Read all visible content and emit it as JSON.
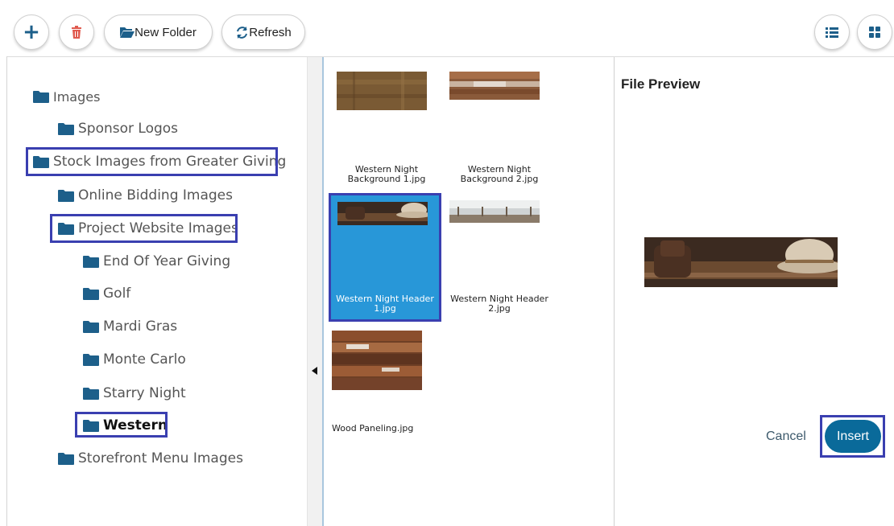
{
  "toolbar": {
    "add_icon_glyph": "+",
    "new_folder_label": "New Folder",
    "refresh_label": "Refresh"
  },
  "tree": {
    "items": [
      {
        "label": "Images",
        "level": 0
      },
      {
        "label": "Sponsor Logos",
        "level": 1
      },
      {
        "label": "Stock Images from Greater Giving",
        "level": 0
      },
      {
        "label": "Online Bidding Images",
        "level": 1
      },
      {
        "label": "Project Website Images",
        "level": 1
      },
      {
        "label": "End Of Year Giving",
        "level": 2
      },
      {
        "label": "Golf",
        "level": 2
      },
      {
        "label": "Mardi Gras",
        "level": 2
      },
      {
        "label": "Monte Carlo",
        "level": 2
      },
      {
        "label": "Starry Night",
        "level": 2
      },
      {
        "label": "Western",
        "level": 2,
        "selected": true
      },
      {
        "label": "Storefront Menu Images",
        "level": 1
      }
    ]
  },
  "files": [
    {
      "name": "Western Night Background 1.jpg",
      "selected": false
    },
    {
      "name": "Western Night Background 2.jpg",
      "selected": false
    },
    {
      "name": "Western Night Header 1.jpg",
      "selected": true
    },
    {
      "name": "Western Night Header 2.jpg",
      "selected": false
    },
    {
      "name": "Wood Paneling.jpg",
      "selected": false
    }
  ],
  "preview": {
    "title": "File Preview",
    "cancel_label": "Cancel",
    "insert_label": "Insert"
  },
  "colors": {
    "accent": "#1d5f8a",
    "selected_tile": "#2897d8",
    "highlight_box": "#3a3fb0",
    "insert_button": "#0a6a9a"
  }
}
